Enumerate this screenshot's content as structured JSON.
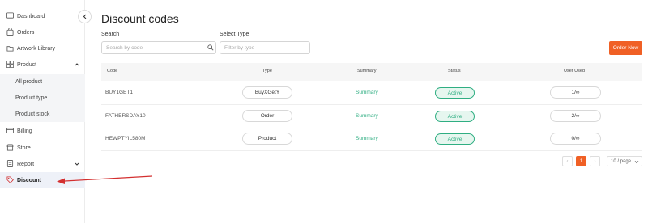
{
  "sidebar": {
    "items": [
      {
        "label": "Dashboard",
        "icon": "dashboard-icon"
      },
      {
        "label": "Orders",
        "icon": "orders-icon"
      },
      {
        "label": "Artwork Library",
        "icon": "artwork-library-icon"
      },
      {
        "label": "Product",
        "icon": "product-icon"
      },
      {
        "label": "Billing",
        "icon": "billing-icon"
      },
      {
        "label": "Store",
        "icon": "store-icon"
      },
      {
        "label": "Report",
        "icon": "report-icon"
      },
      {
        "label": "Discount",
        "icon": "discount-tag-icon"
      }
    ],
    "product_sub": [
      "All product",
      "Product type",
      "Product stock"
    ],
    "active": "Discount"
  },
  "header": {
    "title": "Discount codes"
  },
  "filters": {
    "search_label": "Search",
    "search_placeholder": "Search by code",
    "type_label": "Select Type",
    "type_placeholder": "Filter by type",
    "order_now": "Order Now"
  },
  "table": {
    "columns": [
      "Code",
      "Type",
      "Summary",
      "Status",
      "User Used"
    ],
    "rows": [
      {
        "code": "BUY1GET1",
        "type": "BuyXGetY",
        "summary": "Summary",
        "status": "Active",
        "used": "1/∞"
      },
      {
        "code": "FATHERSDAY10",
        "type": "Order",
        "summary": "Summary",
        "status": "Active",
        "used": "2/∞"
      },
      {
        "code": "HEWPTYIL580M",
        "type": "Product",
        "summary": "Summary",
        "status": "Active",
        "used": "0/∞"
      }
    ]
  },
  "pagination": {
    "prev": "‹",
    "current": "1",
    "next": "›",
    "page_size": "10 / page"
  },
  "colors": {
    "accent": "#f06025",
    "success": "#2fae82",
    "arrow": "#d32f2f"
  }
}
